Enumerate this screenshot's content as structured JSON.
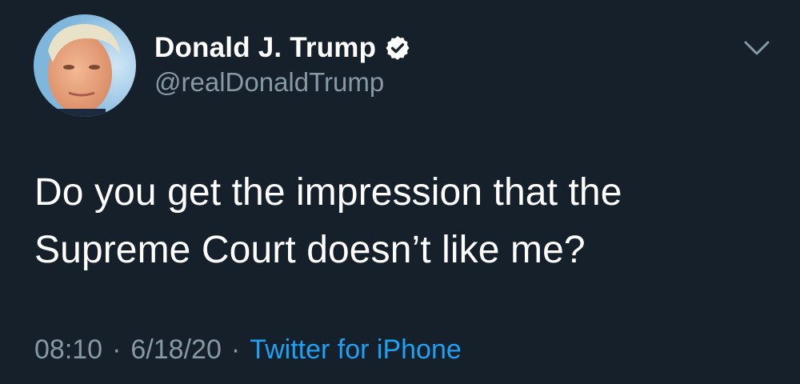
{
  "user": {
    "display_name": "Donald J. Trump",
    "handle": "@realDonaldTrump",
    "verified": true
  },
  "tweet": {
    "text_line1": "Do you get the impression that the",
    "text_line2": "Supreme Court doesn’t like me?",
    "time": "08:10",
    "separator": "·",
    "date": "6/18/20",
    "source": "Twitter for iPhone"
  },
  "icons": {
    "verified": "verified-badge-icon",
    "more": "chevron-down-icon"
  },
  "colors": {
    "background": "#15202b",
    "primary_text": "#ffffff",
    "secondary_text": "#8899a6",
    "link": "#1da1f2"
  }
}
